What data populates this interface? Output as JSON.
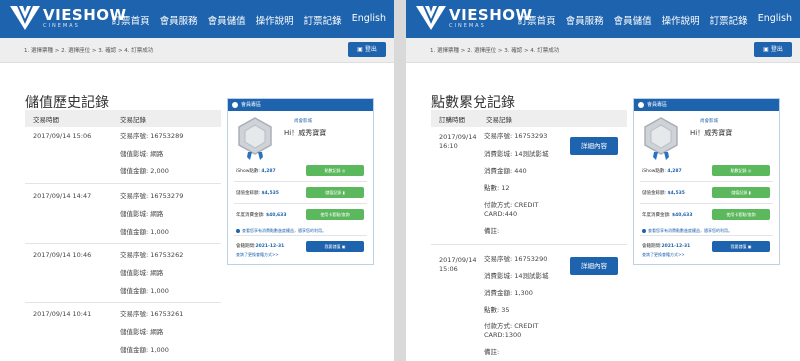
{
  "header": {
    "brand": "VIESHOW",
    "brand_sub": "CINEMAS",
    "nav": [
      "訂票首頁",
      "會員服務",
      "會員儲值",
      "操作說明",
      "訂票記錄",
      "English"
    ]
  },
  "stepbar": {
    "steps": "1. 選擇票種 > 2. 選擇座位 > 3. 確認 > 4. 訂票成功",
    "logout_label": "登出"
  },
  "member_card": {
    "header": "會員專區",
    "member_type": "尚會影城",
    "greeting": "Hi！威秀寶寶",
    "points_label": "iShow點數:",
    "points_value": "4,287",
    "points_button": "點數記錄 ◎",
    "balance_label": "儲值金餘額:",
    "balance_value": "$4,535",
    "balance_button": "儲值記錄 ▮",
    "annual_label": "年度消費金額:",
    "annual_value": "$40,633",
    "annual_button": "使用卡套點/查詢",
    "note": "查看您享有消費點數進度權益，隨享您的利用。",
    "expiry_label": "會籍期間:",
    "expiry_value": "2021-12-31",
    "renew_button": "我要儲值 ▣",
    "link": "查詢了更換會籍方式>>"
  },
  "left": {
    "title": "儲值歷史記錄",
    "columns": [
      "交易時間",
      "交易記錄"
    ],
    "rows": [
      {
        "time": "2017/09/14 15:06",
        "serial": "交易序號: 16753289",
        "location": "儲值影城: 網路",
        "amount": "儲值金額: 2,000"
      },
      {
        "time": "2017/09/14 14:47",
        "serial": "交易序號: 16753279",
        "location": "儲值影城: 網路",
        "amount": "儲值金額: 1,000"
      },
      {
        "time": "2017/09/14 10:46",
        "serial": "交易序號: 16753262",
        "location": "儲值影城: 網路",
        "amount": "儲值金額: 1,000"
      },
      {
        "time": "2017/09/14 10:41",
        "serial": "交易序號: 16753261",
        "location": "儲值影城: 網路",
        "amount": "儲值金額: 1,000"
      }
    ]
  },
  "right": {
    "title": "點數累兌記錄",
    "columns": [
      "訂購時間",
      "交易記錄"
    ],
    "detail_button": "詳細內容",
    "rows": [
      {
        "date": "2017/09/14",
        "time": "16:10",
        "serial": "交易序號: 16753293",
        "location": "消費影城: 14測試影城",
        "amount": "消費金額: 440",
        "points": "點數: 12",
        "pay1": "付款方式: CREDIT",
        "pay2": "CARD:440",
        "remark": "備註:"
      },
      {
        "date": "2017/09/14",
        "time": "15:06",
        "serial": "交易序號: 16753290",
        "location": "消費影城: 14測試影城",
        "amount": "消費金額: 1,300",
        "points": "點數: 35",
        "pay1": "付款方式: CREDIT",
        "pay2": "CARD:1300",
        "remark": "備註:"
      }
    ]
  },
  "colors": {
    "brand": "#1e63ad",
    "button_green": "#5cb85c"
  }
}
